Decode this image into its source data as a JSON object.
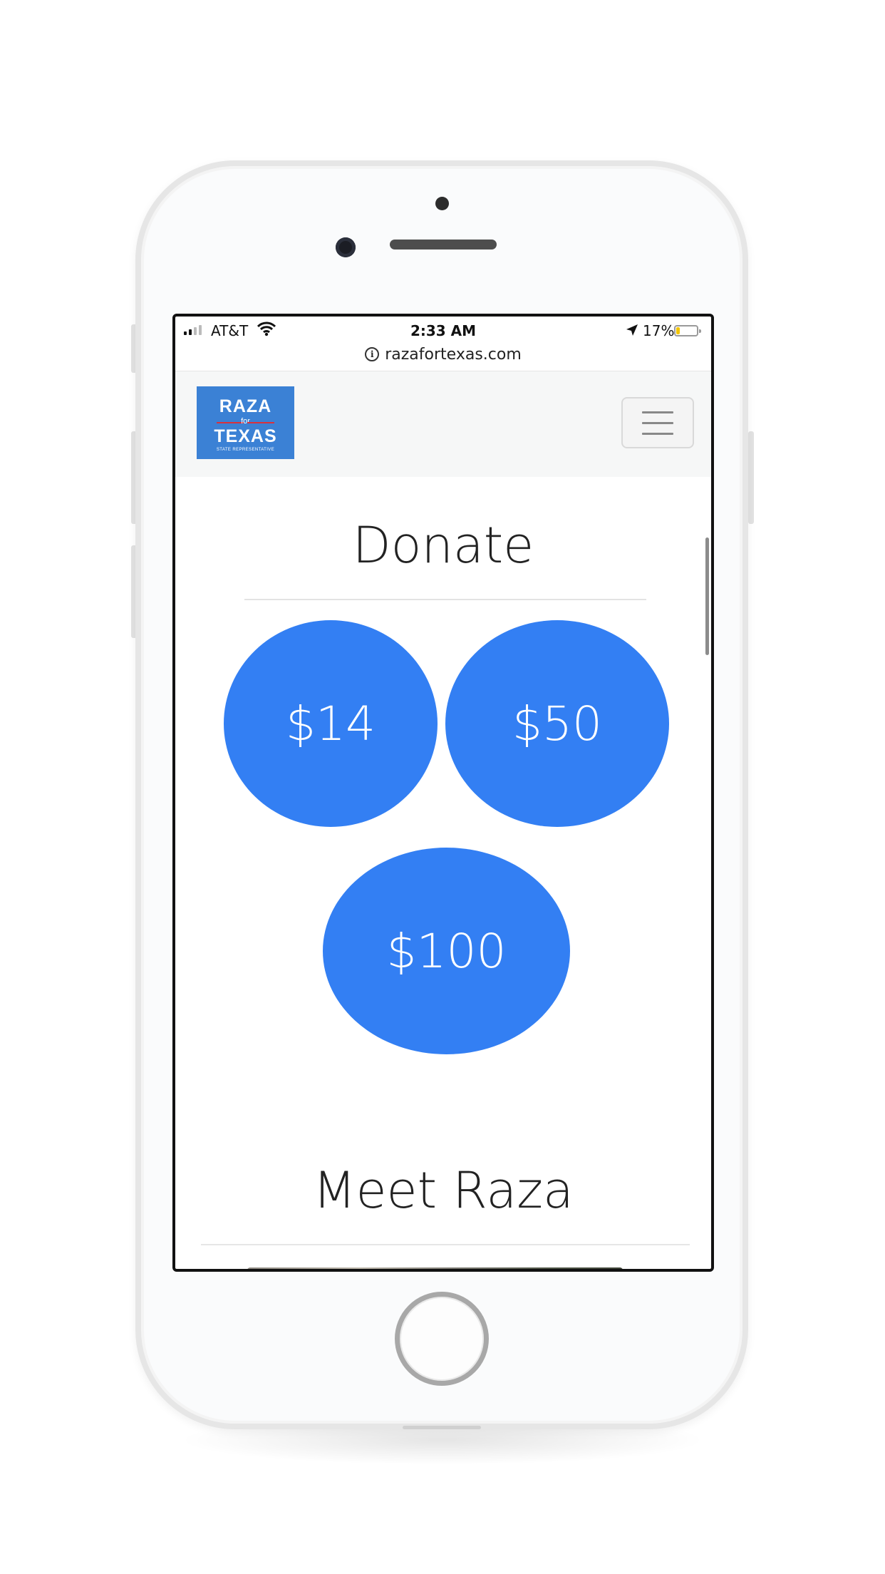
{
  "status_bar": {
    "carrier": "AT&T",
    "time": "2:33 AM",
    "battery_percent": "17%",
    "battery_level": 0.17,
    "signal_icon": "signal-bars-icon",
    "wifi_icon": "wifi-icon",
    "location_icon": "location-arrow-icon"
  },
  "address_bar": {
    "url": "razafortexas.com",
    "icon": "info-icon",
    "info_glyph": "i"
  },
  "navbar": {
    "logo": {
      "line1": "RAZA",
      "connector": "for",
      "line2": "TEXAS",
      "subtitle": "STATE REPRESENTATIVE"
    },
    "menu_icon": "hamburger-menu-icon"
  },
  "donate": {
    "title": "Donate",
    "amounts": [
      "$14",
      "$50",
      "$100"
    ],
    "button_color": "#337ff3"
  },
  "meet": {
    "title": "Meet Raza"
  },
  "colors": {
    "brand_blue": "#3b81d5",
    "accent_red": "#d9313c",
    "battery_low": "#f2c500"
  }
}
